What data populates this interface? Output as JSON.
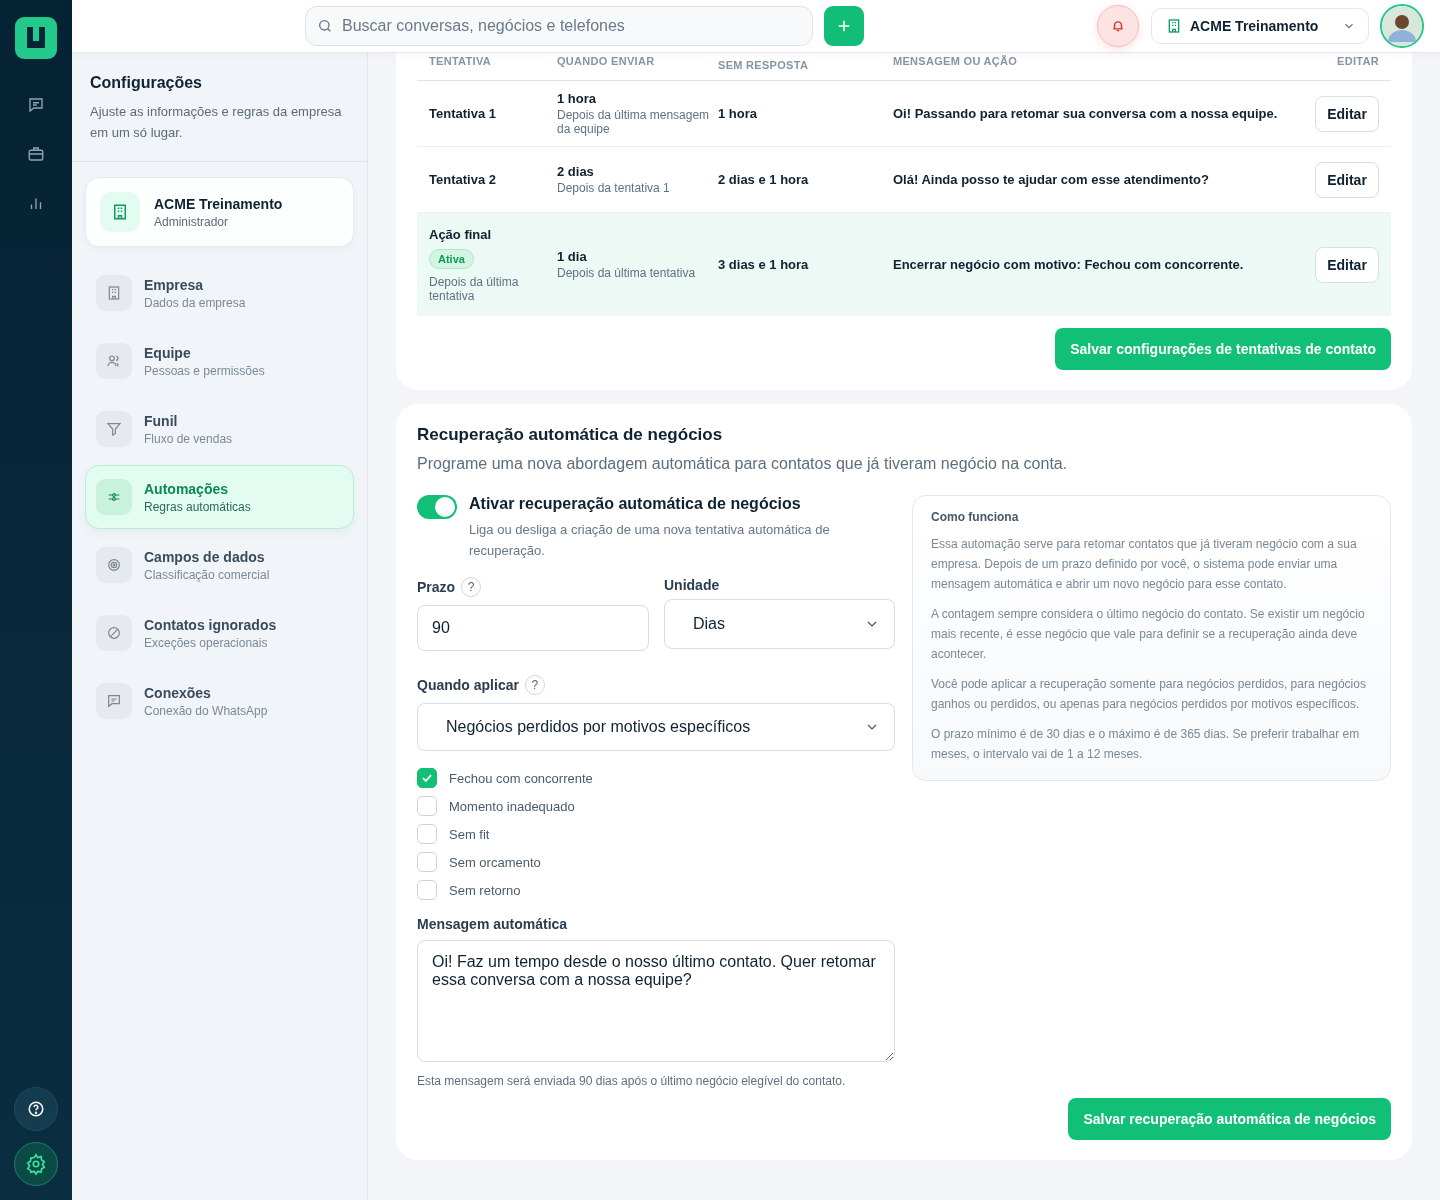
{
  "rail": {
    "items": [
      {
        "selected": false
      },
      {
        "selected": false
      },
      {
        "selected": false
      }
    ],
    "bottom": [
      {
        "selected": false
      },
      {
        "selected": true
      }
    ]
  },
  "topbar": {
    "search": {
      "placeholder": "Buscar conversas, negócios e telefones"
    },
    "company": "ACME Treinamento"
  },
  "sidebar": {
    "title": "Configurações",
    "subtitle": "Ajuste as informações e regras da empresa em um só lugar.",
    "account": {
      "name": "ACME Treinamento",
      "role": "Administrador"
    },
    "items": [
      {
        "title": "Empresa",
        "subtitle": "Dados da empresa",
        "selected": false
      },
      {
        "title": "Equipe",
        "subtitle": "Pessoas e permissões",
        "selected": false
      },
      {
        "title": "Funil",
        "subtitle": "Fluxo de vendas",
        "selected": false
      },
      {
        "title": "Automações",
        "subtitle": "Regras automáticas",
        "selected": true
      },
      {
        "title": "Campos de dados",
        "subtitle": "Classificação comercial",
        "selected": false
      },
      {
        "title": "Contatos ignorados",
        "subtitle": "Exceções operacionais",
        "selected": false
      },
      {
        "title": "Conexões",
        "subtitle": "Conexão do WhatsApp",
        "selected": false
      }
    ]
  },
  "attempts": {
    "columns": [
      "TENTATIVA",
      "QUANDO ENVIAR",
      "SEM RESPOSTA",
      "MENSAGEM OU AÇÃO",
      "EDITAR"
    ],
    "rows": [
      {
        "kind": "attempt",
        "name": "Tentativa 1",
        "when": "1 hora",
        "when_note": "Depois da última mensagem da equipe",
        "no_reply": "1 hora",
        "message": "Oi! Passando para retomar sua conversa com a nossa equipe.",
        "action": "Editar"
      },
      {
        "kind": "attempt",
        "name": "Tentativa 2",
        "when": "2 dias",
        "when_note": "Depois da tentativa 1",
        "no_reply": "2 dias e 1 hora",
        "message": "Olá! Ainda posso te ajudar com esse atendimento?",
        "action": "Editar"
      },
      {
        "kind": "final",
        "name": "Ação final",
        "badge": "Ativa",
        "note": "Depois da última tentativa",
        "when": "1 dia",
        "when_note": "Depois da última tentativa",
        "no_reply": "3 dias e 1 hora",
        "message": "Encerrar negócio com motivo: Fechou com concorrente.",
        "action": "Editar"
      }
    ],
    "save_button": "Salvar configurações de tentativas de contato"
  },
  "recovery": {
    "title": "Recuperação automática de negócios",
    "description": "Programe uma nova abordagem automática para contatos que já tiveram negócio na conta.",
    "toggle": {
      "label": "Ativar recuperação automática de negócios",
      "hint": "Liga ou desliga a criação de uma nova tentativa automática de recuperação.",
      "on": true
    },
    "term": {
      "label": "Prazo",
      "help": "?",
      "value": "90"
    },
    "unit": {
      "label": "Unidade",
      "value": "Dias"
    },
    "apply": {
      "label": "Quando aplicar",
      "help": "?",
      "value": "Negócios perdidos por motivos específicos"
    },
    "reasons": [
      {
        "label": "Fechou com concorrente",
        "checked": true
      },
      {
        "label": "Momento inadequado",
        "checked": false
      },
      {
        "label": "Sem fit",
        "checked": false
      },
      {
        "label": "Sem orcamento",
        "checked": false
      },
      {
        "label": "Sem retorno",
        "checked": false
      }
    ],
    "message": {
      "label": "Mensagem automática",
      "value": "Oi! Faz um tempo desde o nosso último contato. Quer retomar essa conversa com a nossa equipe?"
    },
    "footnote": "Esta mensagem será enviada 90 dias após o último negócio elegível do contato.",
    "save_button": "Salvar recuperação automática de negócios",
    "info": {
      "title": "Como funciona",
      "paragraphs": [
        "Essa automação serve para retomar contatos que já tiveram negócio com a sua empresa. Depois de um prazo definido por você, o sistema pode enviar uma mensagem automática e abrir um novo negócio para esse contato.",
        "A contagem sempre considera o último negócio do contato. Se existir um negócio mais recente, é esse negócio que vale para definir se a recuperação ainda deve acontecer.",
        "Você pode aplicar a recuperação somente para negócios perdidos, para negócios ganhos ou perdidos, ou apenas para negócios perdidos por motivos específicos.",
        "O prazo mínimo é de 30 dias e o máximo é de 365 dias. Se preferir trabalhar em meses, o intervalo vai de 1 a 12 meses."
      ]
    }
  }
}
